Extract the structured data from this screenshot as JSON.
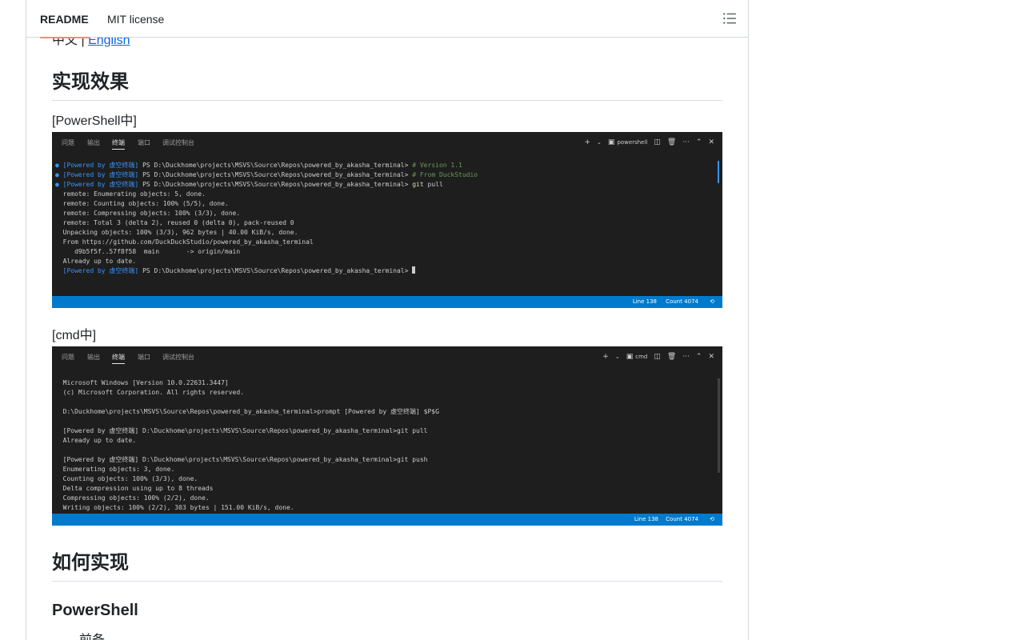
{
  "tabs": [
    {
      "label": "README",
      "active": true
    },
    {
      "label": "MIT license",
      "active": false
    }
  ],
  "icons": {
    "toc": "list-unordered-icon"
  },
  "lang_switch": {
    "current": "中文",
    "separator": " | ",
    "other": "English"
  },
  "sections": {
    "effect_title": "实现效果",
    "powershell_caption": "[PowerShell中]",
    "cmd_caption": "[cmd中]",
    "how_title": "如何实现",
    "powershell_sub": "PowerShell",
    "cut_text": "前备"
  },
  "terminal_tabs": [
    "问题",
    "输出",
    "终端",
    "端口",
    "调试控制台"
  ],
  "terminal_ps": {
    "shell_name": "powershell",
    "active_tab": "终端",
    "lines": [
      {
        "prefix": "● ",
        "prompt": "[Powered by 虚空终端]",
        "path": " PS D:\\Duckhome\\projects\\MSVS\\Source\\Repos\\powered_by_akasha_terminal> ",
        "cmd": "# Version 1.1",
        "cmd_class": "green"
      },
      {
        "prefix": "● ",
        "prompt": "[Powered by 虚空终端]",
        "path": " PS D:\\Duckhome\\projects\\MSVS\\Source\\Repos\\powered_by_akasha_terminal> ",
        "cmd": "# From DuckStudio",
        "cmd_class": "green"
      },
      {
        "prefix": "● ",
        "prompt": "[Powered by 虚空终端]",
        "path": " PS D:\\Duckhome\\projects\\MSVS\\Source\\Repos\\powered_by_akasha_terminal> ",
        "cmd": "git",
        "cmd_class": "yel",
        "rest": " pull"
      },
      {
        "text": "  remote: Enumerating objects: 5, done."
      },
      {
        "text": "  remote: Counting objects: 100% (5/5), done."
      },
      {
        "text": "  remote: Compressing objects: 100% (3/3), done."
      },
      {
        "text": "  remote: Total 3 (delta 2), reused 0 (delta 0), pack-reused 0"
      },
      {
        "text": "  Unpacking objects: 100% (3/3), 962 bytes | 40.00 KiB/s, done."
      },
      {
        "text": "  From https://github.com/DuckDuckStudio/powered_by_akasha_terminal"
      },
      {
        "text": "     d9b5f5f..57f8f58  main       -> origin/main"
      },
      {
        "text": "  Already up to date."
      },
      {
        "prefix": "  ",
        "prompt": "[Powered by 虚空终端]",
        "path": " PS D:\\Duckhome\\projects\\MSVS\\Source\\Repos\\powered_by_akasha_terminal> ",
        "cursor": true
      }
    ],
    "status_line": "Line 138",
    "status_count": "Count 4074"
  },
  "terminal_cmd": {
    "shell_name": "cmd",
    "active_tab": "终端",
    "lines": [
      {
        "text": "  Microsoft Windows [Version 10.0.22631.3447]"
      },
      {
        "text": "  (c) Microsoft Corporation. All rights reserved."
      },
      {
        "text": ""
      },
      {
        "text": "  D:\\Duckhome\\projects\\MSVS\\Source\\Repos\\powered_by_akasha_terminal>prompt [Powered by 虚空终端] $P$G"
      },
      {
        "text": ""
      },
      {
        "text": "  [Powered by 虚空终端] D:\\Duckhome\\projects\\MSVS\\Source\\Repos\\powered_by_akasha_terminal>git pull"
      },
      {
        "text": "  Already up to date."
      },
      {
        "text": ""
      },
      {
        "text": "  [Powered by 虚空终端] D:\\Duckhome\\projects\\MSVS\\Source\\Repos\\powered_by_akasha_terminal>git push"
      },
      {
        "text": "  Enumerating objects: 3, done."
      },
      {
        "text": "  Counting objects: 100% (3/3), done."
      },
      {
        "text": "  Delta compression using up to 8 threads"
      },
      {
        "text": "  Compressing objects: 100% (2/2), done."
      },
      {
        "text": "  Writing objects: 100% (2/2), 303 bytes | 151.00 KiB/s, done."
      }
    ],
    "status_line": "Line 138",
    "status_count": "Count 4074"
  },
  "colors": {
    "accent_tab": "#fd8c73",
    "link": "#0969da",
    "terminal_bg": "#1e1e1e",
    "statusbar": "#007acc"
  }
}
